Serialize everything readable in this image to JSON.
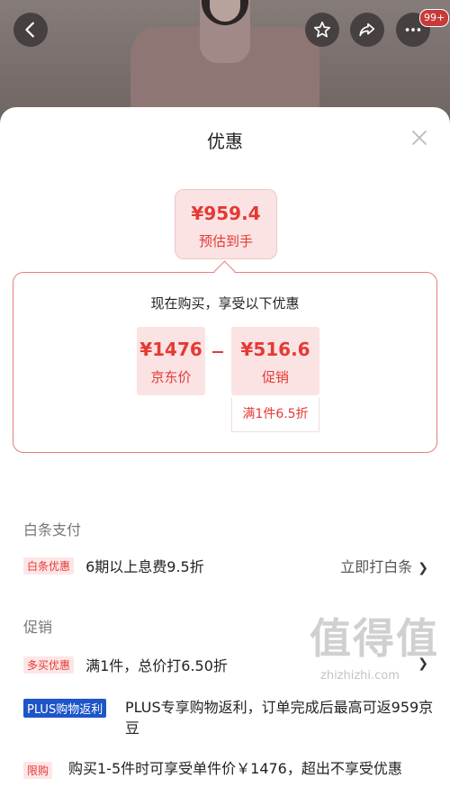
{
  "header": {
    "more_badge": "99+",
    "icons": [
      "back-icon",
      "star-icon",
      "share-icon",
      "more-icon"
    ]
  },
  "sheet": {
    "title": "优惠",
    "estimate": {
      "price": "¥959.4",
      "label": "预估到手"
    },
    "breakdown": {
      "title": "现在购买，享受以下优惠",
      "jd_price": {
        "value": "¥1476",
        "label": "京东价"
      },
      "promo": {
        "value": "¥516.6",
        "label": "促销",
        "detail": "满1件6.5折"
      }
    },
    "baitiao": {
      "section_title": "白条支付",
      "tag": "白条优惠",
      "text": "6期以上息费9.5折",
      "action": "立即打白条"
    },
    "promotions": {
      "section_title": "促销",
      "items": [
        {
          "tag": "多买优惠",
          "text": "满1件，总价打6.50折"
        },
        {
          "tag": "PLUS购物返利",
          "text": "PLUS专享购物返利，订单完成后最高可返959京豆"
        },
        {
          "tag": "限购",
          "text": "购买1-5件时可享受单件价￥1476，超出不享受优惠"
        }
      ]
    }
  },
  "watermark": {
    "main": "值得值",
    "sub": "zhizhizhi.com"
  },
  "colors": {
    "accent": "#e53935",
    "tag_bg": "#fde6e6",
    "plus_blue": "#1e55c8",
    "panel_border": "#e97b7b"
  }
}
